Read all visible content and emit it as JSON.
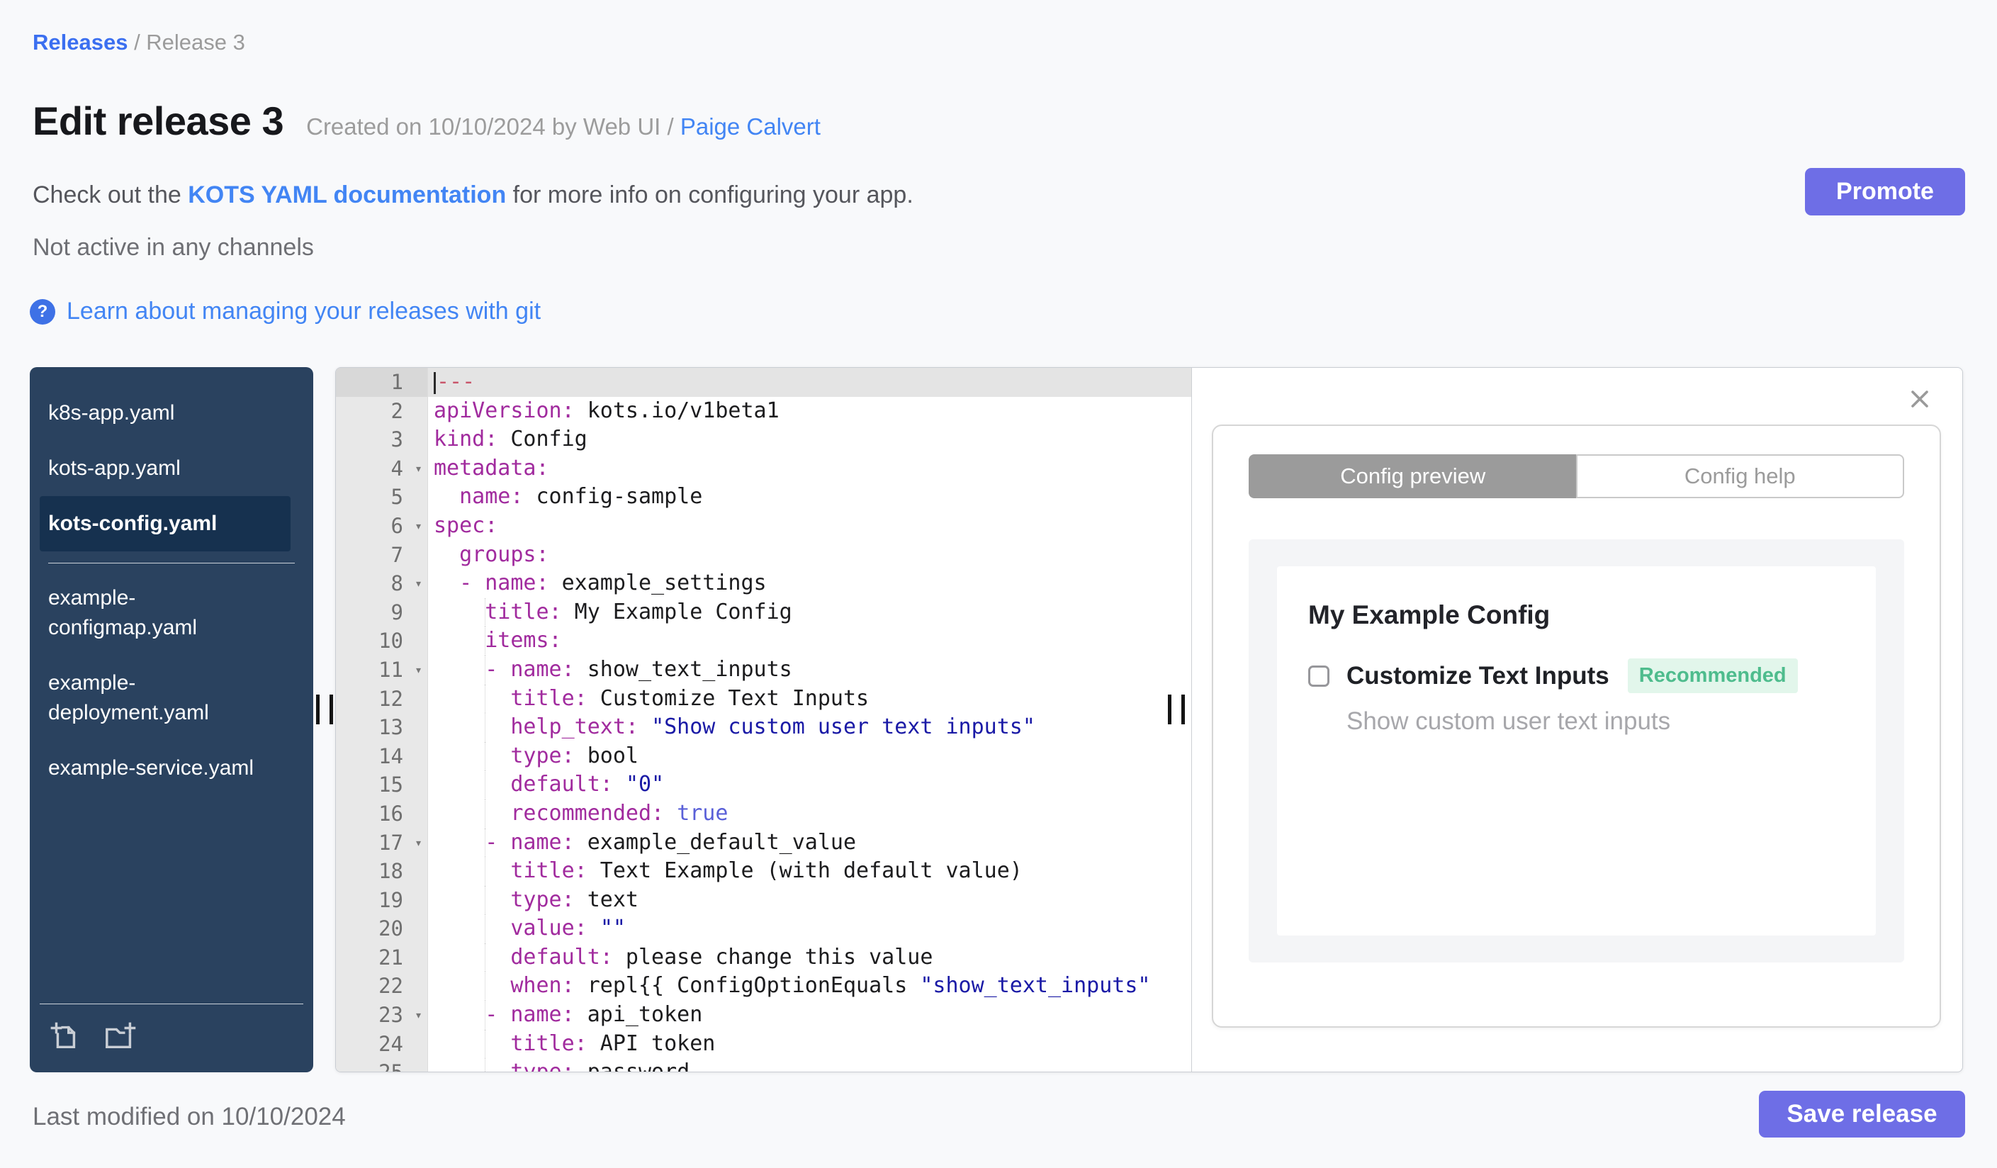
{
  "colors": {
    "accent": "#6e6ee6",
    "link": "#4285f4",
    "link_dark": "#3b6ff0",
    "sidebar_bg": "#2a425f",
    "sidebar_selected_bg": "#16314f",
    "badge_bg": "#e2f6eb",
    "badge_text": "#4ebc8d",
    "tab_active_bg": "#9b9b9b",
    "code_key": "#a12b9e",
    "code_string": "#1a1aa6",
    "code_bool": "#5a60d8",
    "code_separator": "#c9566b"
  },
  "breadcrumb": {
    "link": "Releases",
    "separator": " / ",
    "current": "Release 3"
  },
  "header": {
    "title": "Edit release 3",
    "created_text": "Created on 10/10/2024 by Web UI / ",
    "created_link": "Paige Calvert",
    "doc_prefix": "Check out the ",
    "doc_link": "KOTS YAML documentation",
    "doc_suffix": " for more info on configuring your app.",
    "promote_label": "Promote",
    "channel_status": "Not active in any channels",
    "help_icon": "?",
    "git_link": "Learn about managing your releases with git"
  },
  "sidebar": {
    "files_top": [
      {
        "label": "k8s-app.yaml",
        "selected": false
      },
      {
        "label": "kots-app.yaml",
        "selected": false
      },
      {
        "label": "kots-config.yaml",
        "selected": true
      }
    ],
    "files_bottom": [
      {
        "label": "example-configmap.yaml",
        "selected": false
      },
      {
        "label": "example-deployment.yaml",
        "selected": false
      },
      {
        "label": "example-service.yaml",
        "selected": false
      }
    ],
    "actions": [
      "new-file",
      "new-folder"
    ]
  },
  "editor": {
    "active_line": 1,
    "fold_lines": [
      4,
      6,
      8,
      11,
      17,
      23
    ],
    "guide_from_line": 9,
    "lines": [
      [
        [
          "sep",
          "---"
        ]
      ],
      [
        [
          "key",
          "apiVersion:"
        ],
        [
          "txt",
          " kots.io/v1beta1"
        ]
      ],
      [
        [
          "key",
          "kind:"
        ],
        [
          "txt",
          " Config"
        ]
      ],
      [
        [
          "key",
          "metadata:"
        ]
      ],
      [
        [
          "txt",
          "  "
        ],
        [
          "key",
          "name:"
        ],
        [
          "txt",
          " config-sample"
        ]
      ],
      [
        [
          "key",
          "spec:"
        ]
      ],
      [
        [
          "txt",
          "  "
        ],
        [
          "key",
          "groups:"
        ]
      ],
      [
        [
          "txt",
          "  "
        ],
        [
          "key",
          "- name:"
        ],
        [
          "txt",
          " example_settings"
        ]
      ],
      [
        [
          "txt",
          "    "
        ],
        [
          "key",
          "title:"
        ],
        [
          "txt",
          " My Example Config"
        ]
      ],
      [
        [
          "txt",
          "    "
        ],
        [
          "key",
          "items:"
        ]
      ],
      [
        [
          "txt",
          "    "
        ],
        [
          "key",
          "- name:"
        ],
        [
          "txt",
          " show_text_inputs"
        ]
      ],
      [
        [
          "txt",
          "      "
        ],
        [
          "key",
          "title:"
        ],
        [
          "txt",
          " Customize Text Inputs"
        ]
      ],
      [
        [
          "txt",
          "      "
        ],
        [
          "key",
          "help_text:"
        ],
        [
          "txt",
          " "
        ],
        [
          "str",
          "\"Show custom user text inputs\""
        ]
      ],
      [
        [
          "txt",
          "      "
        ],
        [
          "key",
          "type:"
        ],
        [
          "txt",
          " bool"
        ]
      ],
      [
        [
          "txt",
          "      "
        ],
        [
          "key",
          "default:"
        ],
        [
          "txt",
          " "
        ],
        [
          "str",
          "\"0\""
        ]
      ],
      [
        [
          "txt",
          "      "
        ],
        [
          "key",
          "recommended:"
        ],
        [
          "txt",
          " "
        ],
        [
          "bool",
          "true"
        ]
      ],
      [
        [
          "txt",
          "    "
        ],
        [
          "key",
          "- name:"
        ],
        [
          "txt",
          " example_default_value"
        ]
      ],
      [
        [
          "txt",
          "      "
        ],
        [
          "key",
          "title:"
        ],
        [
          "txt",
          " Text Example (with default value)"
        ]
      ],
      [
        [
          "txt",
          "      "
        ],
        [
          "key",
          "type:"
        ],
        [
          "txt",
          " text"
        ]
      ],
      [
        [
          "txt",
          "      "
        ],
        [
          "key",
          "value:"
        ],
        [
          "txt",
          " "
        ],
        [
          "str",
          "\"\""
        ]
      ],
      [
        [
          "txt",
          "      "
        ],
        [
          "key",
          "default:"
        ],
        [
          "txt",
          " please change this value"
        ]
      ],
      [
        [
          "txt",
          "      "
        ],
        [
          "key",
          "when:"
        ],
        [
          "txt",
          " repl{{ ConfigOptionEquals "
        ],
        [
          "str",
          "\"show_text_inputs\""
        ]
      ],
      [
        [
          "txt",
          "    "
        ],
        [
          "key",
          "- name:"
        ],
        [
          "txt",
          " api_token"
        ]
      ],
      [
        [
          "txt",
          "      "
        ],
        [
          "key",
          "title:"
        ],
        [
          "txt",
          " API token"
        ]
      ],
      [
        [
          "txt",
          "      "
        ],
        [
          "key",
          "type:"
        ],
        [
          "txt",
          " password"
        ]
      ]
    ]
  },
  "preview": {
    "tabs": [
      {
        "label": "Config preview",
        "active": true
      },
      {
        "label": "Config help",
        "active": false
      }
    ],
    "group_title": "My Example Config",
    "item_label": "Customize Text Inputs",
    "item_badge": "Recommended",
    "item_help": "Show custom user text inputs",
    "item_checked": false
  },
  "footer": {
    "last_modified": "Last modified on 10/10/2024",
    "save_label": "Save release"
  }
}
